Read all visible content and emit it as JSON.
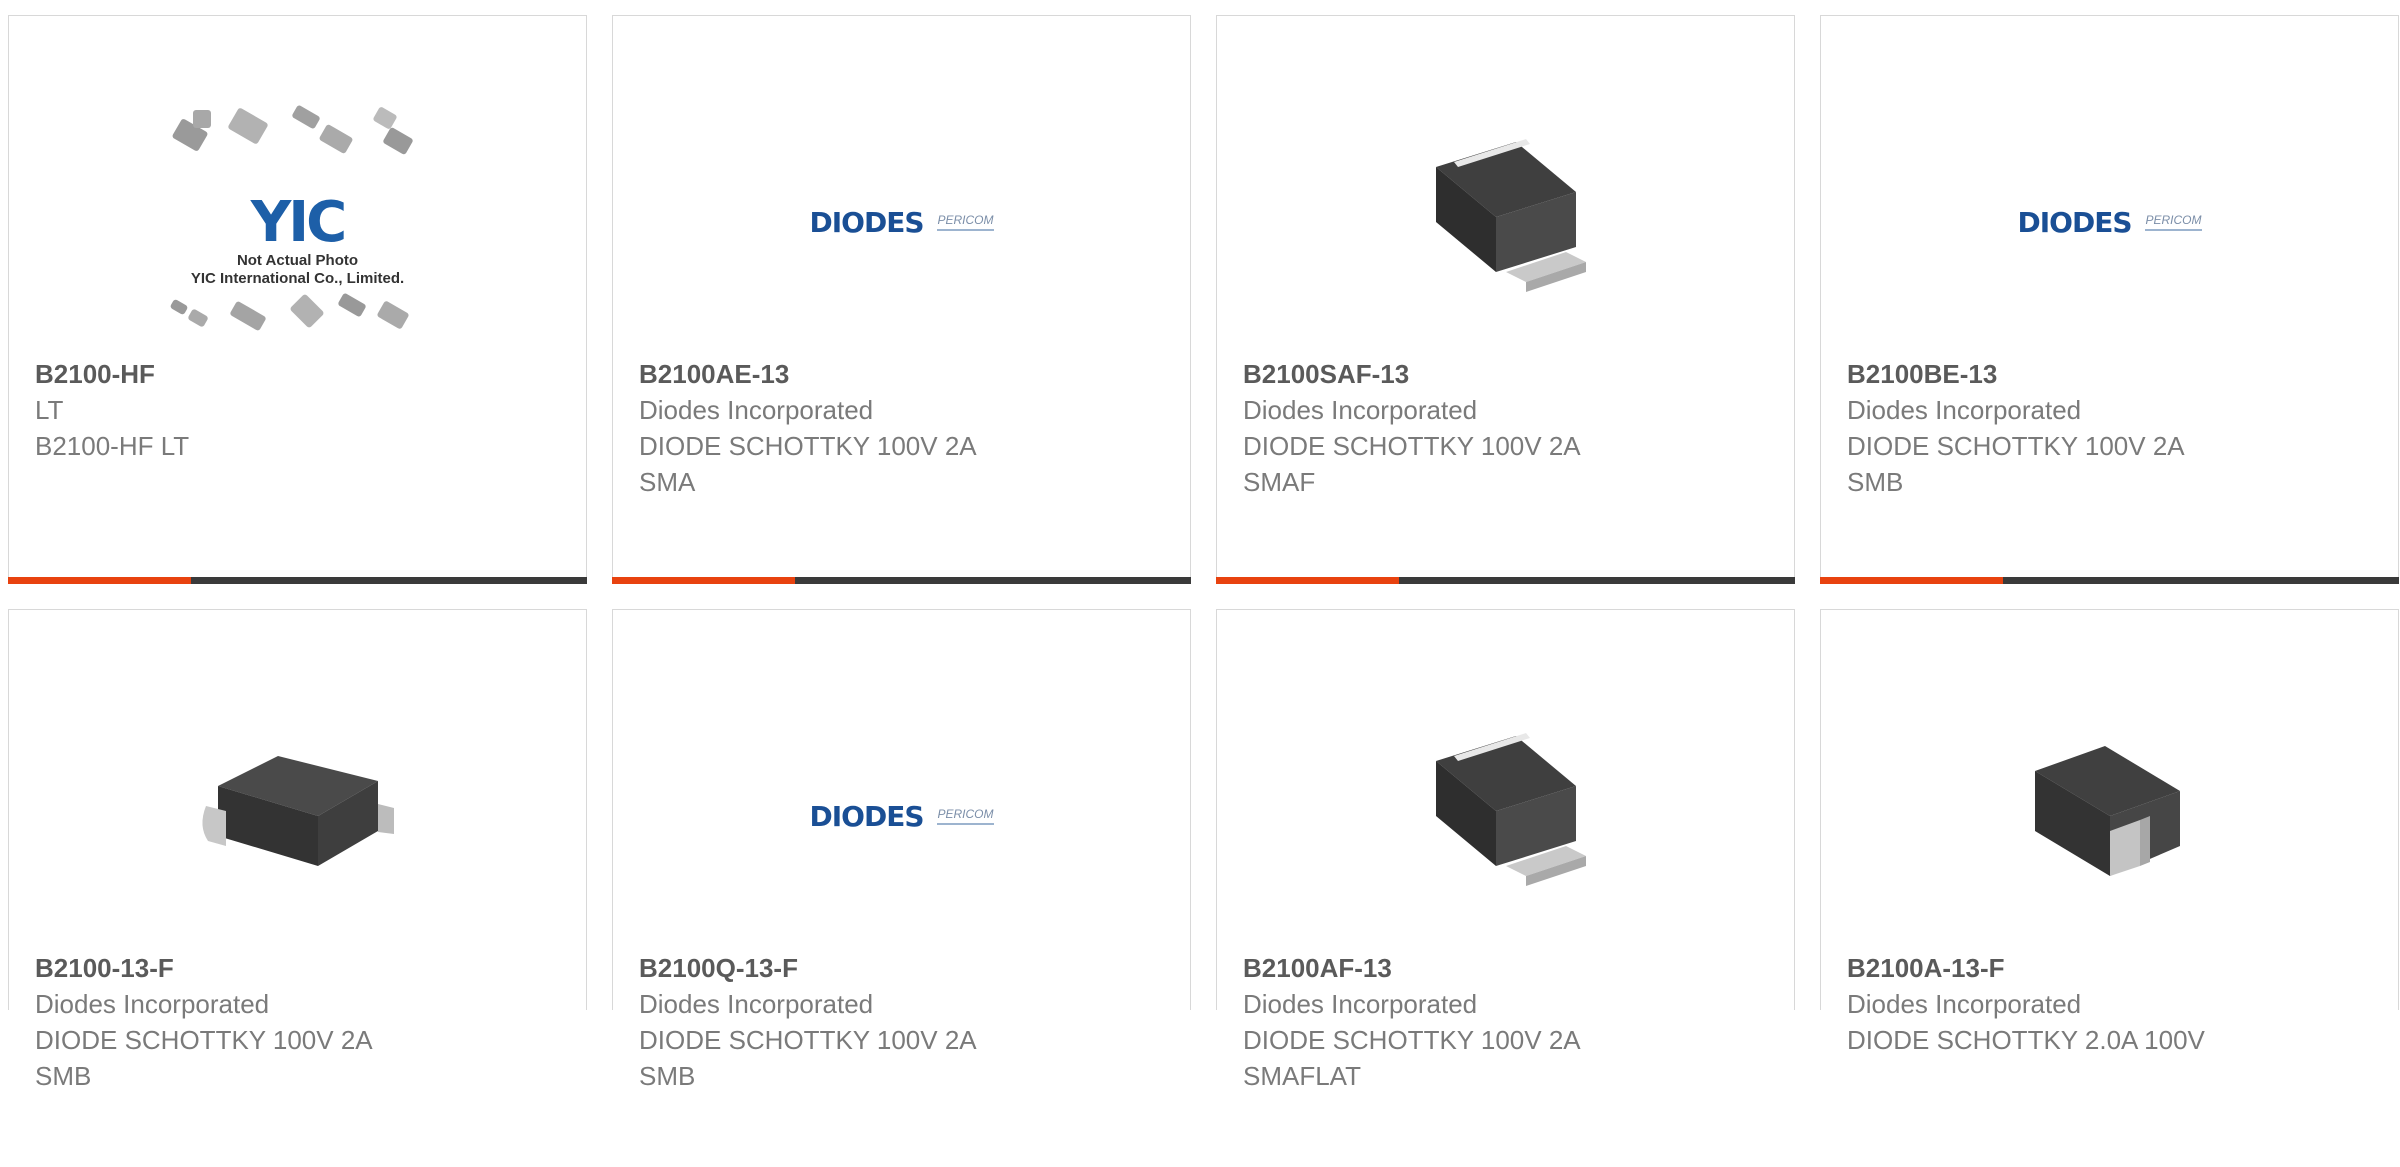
{
  "products": [
    {
      "part": "B2100-HF",
      "image": "not-actual-photo",
      "lines": [
        "LT",
        "B2100-HF LT"
      ]
    },
    {
      "part": "B2100AE-13",
      "image": "diodes-logo",
      "lines": [
        "Diodes Incorporated",
        "DIODE SCHOTTKY 100V 2A",
        "SMA"
      ]
    },
    {
      "part": "B2100SAF-13",
      "image": "smaf-package",
      "lines": [
        "Diodes Incorporated",
        "DIODE SCHOTTKY 100V 2A",
        "SMAF"
      ]
    },
    {
      "part": "B2100BE-13",
      "image": "diodes-logo",
      "lines": [
        "Diodes Incorporated",
        "DIODE SCHOTTKY 100V 2A",
        "SMB"
      ]
    },
    {
      "part": "B2100-13-F",
      "image": "smb-package",
      "lines": [
        "Diodes Incorporated",
        "DIODE SCHOTTKY 100V 2A",
        "SMB"
      ]
    },
    {
      "part": "B2100Q-13-F",
      "image": "diodes-logo",
      "lines": [
        "Diodes Incorporated",
        "DIODE SCHOTTKY 100V 2A",
        "SMB"
      ]
    },
    {
      "part": "B2100AF-13",
      "image": "smaf-package",
      "lines": [
        "Diodes Incorporated",
        "DIODE SCHOTTKY 100V 2A",
        "SMAFLAT"
      ]
    },
    {
      "part": "B2100A-13-F",
      "image": "sma-package",
      "lines": [
        "Diodes Incorporated",
        "DIODE SCHOTTKY 2.0A 100V"
      ]
    }
  ],
  "placeholder_image": {
    "logo_text": "YIC",
    "caption_line1": "Not Actual Photo",
    "caption_line2": "YIC International Co., Limited."
  },
  "diodes_logo": {
    "brand": "DIODES",
    "sub": "PERICOM"
  },
  "colors": {
    "accent": "#e8420f",
    "bar": "#3a3a3a",
    "part_text": "#5a5a5a",
    "body_text": "#7a7a7a",
    "border": "#d8d8d8"
  }
}
